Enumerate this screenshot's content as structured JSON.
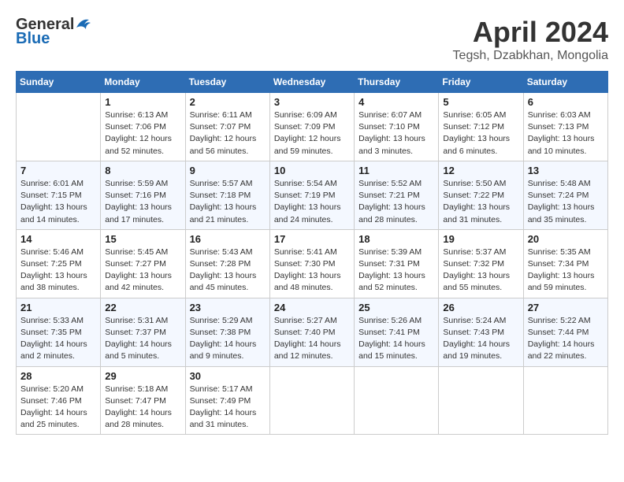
{
  "header": {
    "logo_general": "General",
    "logo_blue": "Blue",
    "month_title": "April 2024",
    "location": "Tegsh, Dzabkhan, Mongolia"
  },
  "days_of_week": [
    "Sunday",
    "Monday",
    "Tuesday",
    "Wednesday",
    "Thursday",
    "Friday",
    "Saturday"
  ],
  "weeks": [
    [
      {
        "day": "",
        "sunrise": "",
        "sunset": "",
        "daylight": ""
      },
      {
        "day": "1",
        "sunrise": "Sunrise: 6:13 AM",
        "sunset": "Sunset: 7:06 PM",
        "daylight": "Daylight: 12 hours and 52 minutes."
      },
      {
        "day": "2",
        "sunrise": "Sunrise: 6:11 AM",
        "sunset": "Sunset: 7:07 PM",
        "daylight": "Daylight: 12 hours and 56 minutes."
      },
      {
        "day": "3",
        "sunrise": "Sunrise: 6:09 AM",
        "sunset": "Sunset: 7:09 PM",
        "daylight": "Daylight: 12 hours and 59 minutes."
      },
      {
        "day": "4",
        "sunrise": "Sunrise: 6:07 AM",
        "sunset": "Sunset: 7:10 PM",
        "daylight": "Daylight: 13 hours and 3 minutes."
      },
      {
        "day": "5",
        "sunrise": "Sunrise: 6:05 AM",
        "sunset": "Sunset: 7:12 PM",
        "daylight": "Daylight: 13 hours and 6 minutes."
      },
      {
        "day": "6",
        "sunrise": "Sunrise: 6:03 AM",
        "sunset": "Sunset: 7:13 PM",
        "daylight": "Daylight: 13 hours and 10 minutes."
      }
    ],
    [
      {
        "day": "7",
        "sunrise": "Sunrise: 6:01 AM",
        "sunset": "Sunset: 7:15 PM",
        "daylight": "Daylight: 13 hours and 14 minutes."
      },
      {
        "day": "8",
        "sunrise": "Sunrise: 5:59 AM",
        "sunset": "Sunset: 7:16 PM",
        "daylight": "Daylight: 13 hours and 17 minutes."
      },
      {
        "day": "9",
        "sunrise": "Sunrise: 5:57 AM",
        "sunset": "Sunset: 7:18 PM",
        "daylight": "Daylight: 13 hours and 21 minutes."
      },
      {
        "day": "10",
        "sunrise": "Sunrise: 5:54 AM",
        "sunset": "Sunset: 7:19 PM",
        "daylight": "Daylight: 13 hours and 24 minutes."
      },
      {
        "day": "11",
        "sunrise": "Sunrise: 5:52 AM",
        "sunset": "Sunset: 7:21 PM",
        "daylight": "Daylight: 13 hours and 28 minutes."
      },
      {
        "day": "12",
        "sunrise": "Sunrise: 5:50 AM",
        "sunset": "Sunset: 7:22 PM",
        "daylight": "Daylight: 13 hours and 31 minutes."
      },
      {
        "day": "13",
        "sunrise": "Sunrise: 5:48 AM",
        "sunset": "Sunset: 7:24 PM",
        "daylight": "Daylight: 13 hours and 35 minutes."
      }
    ],
    [
      {
        "day": "14",
        "sunrise": "Sunrise: 5:46 AM",
        "sunset": "Sunset: 7:25 PM",
        "daylight": "Daylight: 13 hours and 38 minutes."
      },
      {
        "day": "15",
        "sunrise": "Sunrise: 5:45 AM",
        "sunset": "Sunset: 7:27 PM",
        "daylight": "Daylight: 13 hours and 42 minutes."
      },
      {
        "day": "16",
        "sunrise": "Sunrise: 5:43 AM",
        "sunset": "Sunset: 7:28 PM",
        "daylight": "Daylight: 13 hours and 45 minutes."
      },
      {
        "day": "17",
        "sunrise": "Sunrise: 5:41 AM",
        "sunset": "Sunset: 7:30 PM",
        "daylight": "Daylight: 13 hours and 48 minutes."
      },
      {
        "day": "18",
        "sunrise": "Sunrise: 5:39 AM",
        "sunset": "Sunset: 7:31 PM",
        "daylight": "Daylight: 13 hours and 52 minutes."
      },
      {
        "day": "19",
        "sunrise": "Sunrise: 5:37 AM",
        "sunset": "Sunset: 7:32 PM",
        "daylight": "Daylight: 13 hours and 55 minutes."
      },
      {
        "day": "20",
        "sunrise": "Sunrise: 5:35 AM",
        "sunset": "Sunset: 7:34 PM",
        "daylight": "Daylight: 13 hours and 59 minutes."
      }
    ],
    [
      {
        "day": "21",
        "sunrise": "Sunrise: 5:33 AM",
        "sunset": "Sunset: 7:35 PM",
        "daylight": "Daylight: 14 hours and 2 minutes."
      },
      {
        "day": "22",
        "sunrise": "Sunrise: 5:31 AM",
        "sunset": "Sunset: 7:37 PM",
        "daylight": "Daylight: 14 hours and 5 minutes."
      },
      {
        "day": "23",
        "sunrise": "Sunrise: 5:29 AM",
        "sunset": "Sunset: 7:38 PM",
        "daylight": "Daylight: 14 hours and 9 minutes."
      },
      {
        "day": "24",
        "sunrise": "Sunrise: 5:27 AM",
        "sunset": "Sunset: 7:40 PM",
        "daylight": "Daylight: 14 hours and 12 minutes."
      },
      {
        "day": "25",
        "sunrise": "Sunrise: 5:26 AM",
        "sunset": "Sunset: 7:41 PM",
        "daylight": "Daylight: 14 hours and 15 minutes."
      },
      {
        "day": "26",
        "sunrise": "Sunrise: 5:24 AM",
        "sunset": "Sunset: 7:43 PM",
        "daylight": "Daylight: 14 hours and 19 minutes."
      },
      {
        "day": "27",
        "sunrise": "Sunrise: 5:22 AM",
        "sunset": "Sunset: 7:44 PM",
        "daylight": "Daylight: 14 hours and 22 minutes."
      }
    ],
    [
      {
        "day": "28",
        "sunrise": "Sunrise: 5:20 AM",
        "sunset": "Sunset: 7:46 PM",
        "daylight": "Daylight: 14 hours and 25 minutes."
      },
      {
        "day": "29",
        "sunrise": "Sunrise: 5:18 AM",
        "sunset": "Sunset: 7:47 PM",
        "daylight": "Daylight: 14 hours and 28 minutes."
      },
      {
        "day": "30",
        "sunrise": "Sunrise: 5:17 AM",
        "sunset": "Sunset: 7:49 PM",
        "daylight": "Daylight: 14 hours and 31 minutes."
      },
      {
        "day": "",
        "sunrise": "",
        "sunset": "",
        "daylight": ""
      },
      {
        "day": "",
        "sunrise": "",
        "sunset": "",
        "daylight": ""
      },
      {
        "day": "",
        "sunrise": "",
        "sunset": "",
        "daylight": ""
      },
      {
        "day": "",
        "sunrise": "",
        "sunset": "",
        "daylight": ""
      }
    ]
  ]
}
